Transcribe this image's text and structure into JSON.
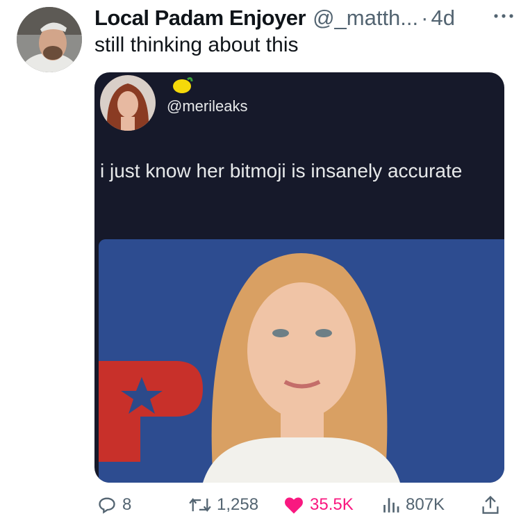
{
  "tweet": {
    "author_name": "Local Padam Enjoyer",
    "author_handle": "@_matth...",
    "separator": "·",
    "time": "4d",
    "text": "still thinking about this"
  },
  "quoted_post": {
    "handle": "@merileaks",
    "text": "i just know her bitmoji is insanely accurate"
  },
  "actions": {
    "replies": "8",
    "retweets": "1,258",
    "likes": "35.5K",
    "views": "807K"
  },
  "icons": {
    "more": "more-icon",
    "reply": "reply-icon",
    "retweet": "retweet-icon",
    "like": "heart-icon",
    "views": "views-icon",
    "share": "share-icon"
  },
  "colors": {
    "text": "#0f1419",
    "secondary": "#536471",
    "like": "#f91880",
    "media_bg": "#16192a"
  }
}
